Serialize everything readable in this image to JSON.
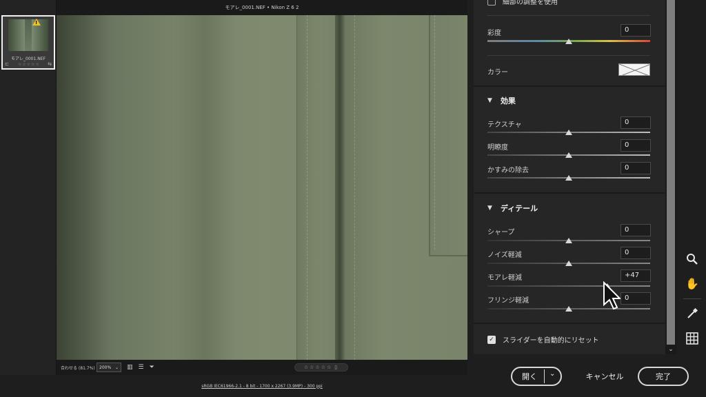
{
  "window": {
    "title": "モアレ_0001.NEF • Nikon Z 6 2"
  },
  "filmstrip": {
    "items": [
      {
        "name": "モアレ_0001.NEF",
        "stars": "☆☆☆☆☆"
      }
    ]
  },
  "canvas_footer": {
    "fit_label": "合わせる (81.7%)",
    "zoom_value": "200%",
    "rating": "☆☆☆☆☆"
  },
  "status": {
    "text": "sRGB IEC61966-2.1 - 8 bit - 1700 x 2267 (3.9MP) - 300 ppi"
  },
  "panel": {
    "fine_adjust_label": "細部の調整を使用",
    "color_section": {
      "saturation": {
        "label": "彩度",
        "value": "0",
        "position": 0.5
      },
      "color_label": "カラー"
    },
    "effects": {
      "title": "効果",
      "sliders": [
        {
          "label": "テクスチャ",
          "value": "0",
          "position": 0.5
        },
        {
          "label": "明瞭度",
          "value": "0",
          "position": 0.5
        },
        {
          "label": "かすみの除去",
          "value": "0",
          "position": 0.5
        }
      ]
    },
    "detail": {
      "title": "ディテール",
      "sliders": [
        {
          "label": "シャープ",
          "value": "0",
          "position": 0.5
        },
        {
          "label": "ノイズ軽減",
          "value": "0",
          "position": 0.5
        },
        {
          "label": "モアレ軽減",
          "value": "+47",
          "position": 0.74
        },
        {
          "label": "フリンジ軽減",
          "value": "0",
          "position": 0.5
        }
      ]
    },
    "auto_reset_label": "スライダーを自動的にリセット"
  },
  "actions": {
    "open_label": "開く",
    "cancel_label": "キャンセル",
    "done_label": "完了"
  },
  "colors": {
    "panel_bg": "#262626",
    "accent": "#d8d8d8"
  }
}
